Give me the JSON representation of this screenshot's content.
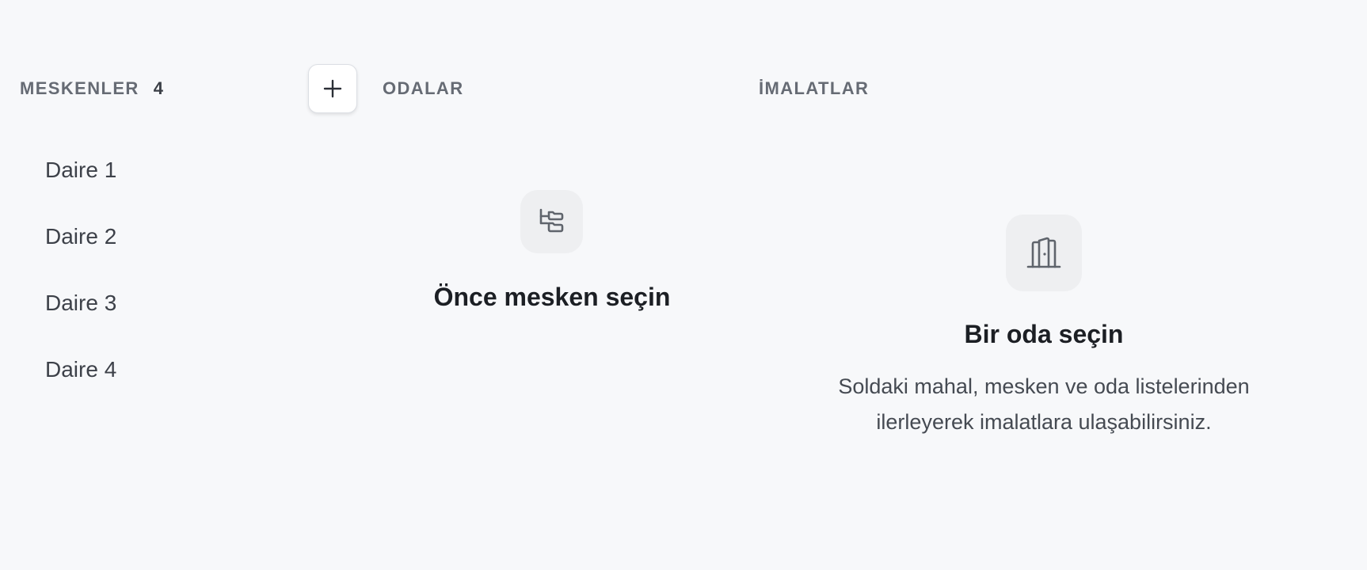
{
  "meskenler": {
    "header": "MESKENLER",
    "count": "4",
    "add_label": "+",
    "items": [
      {
        "label": "Daire 1"
      },
      {
        "label": "Daire 2"
      },
      {
        "label": "Daire 3"
      },
      {
        "label": "Daire 4"
      }
    ]
  },
  "odalar": {
    "header": "ODALAR",
    "empty_icon": "folder-tree-icon",
    "empty_title": "Önce mesken seçin"
  },
  "imalatlar": {
    "header": "İMALATLAR",
    "empty_icon": "door-icon",
    "empty_title": "Bir oda seçin",
    "empty_desc_line1": "Soldaki mahal, mesken ve oda listelerinden",
    "empty_desc_line2": "ilerleyerek imalatlara ulaşabilirsiniz."
  },
  "colors": {
    "background": "#f7f8fa",
    "icon_box": "#eeeff1",
    "header_text": "#666b74",
    "title_text": "#1c1f24"
  }
}
